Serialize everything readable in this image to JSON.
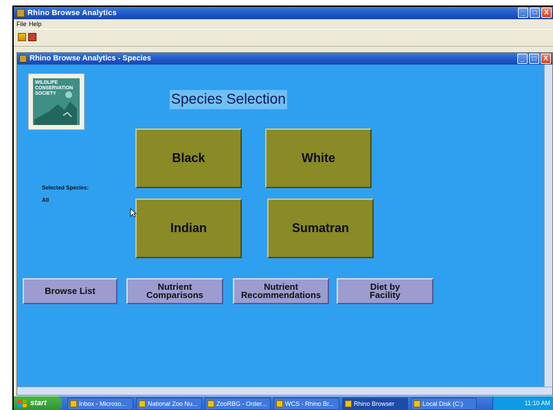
{
  "app": {
    "title": "Rhino Browse Analytics",
    "window_buttons": [
      "_",
      "□",
      "X"
    ]
  },
  "menu": {
    "file": "File",
    "help": "Help"
  },
  "child_window": {
    "title": "Rhino Browse Analytics - Species"
  },
  "logo": {
    "line1": "WILDLIFE",
    "line2": "CONSERVATION",
    "line3": "SOCIETY"
  },
  "main": {
    "heading": "Species Selection",
    "selected_label": "Selected Species:",
    "selected_value": "All",
    "species": [
      "Black",
      "White",
      "Indian",
      "Sumatran"
    ],
    "nav": {
      "browse": "Browse List",
      "nutrient_comp_line1": "Nutrient",
      "nutrient_comp_line2": "Comparisons",
      "nutrient_rec_line1": "Nutrient",
      "nutrient_rec_line2": "Recommendations",
      "diet_line1": "Diet by",
      "diet_line2": "Facility"
    }
  },
  "taskbar": {
    "start": "start",
    "items": [
      "Inbox - Microso...",
      "National Zoo Nu...",
      "ZooRBG - Order...",
      "WCS - Rhino Br...",
      "Rhino Browser",
      "Local Disk (C:)"
    ],
    "clock": "11:10 AM"
  },
  "colors": {
    "background_blue": "#2fa0f0",
    "species_button": "#8a8a26",
    "nav_button": "#9c9cd0",
    "heading_text": "#0b1a56"
  }
}
